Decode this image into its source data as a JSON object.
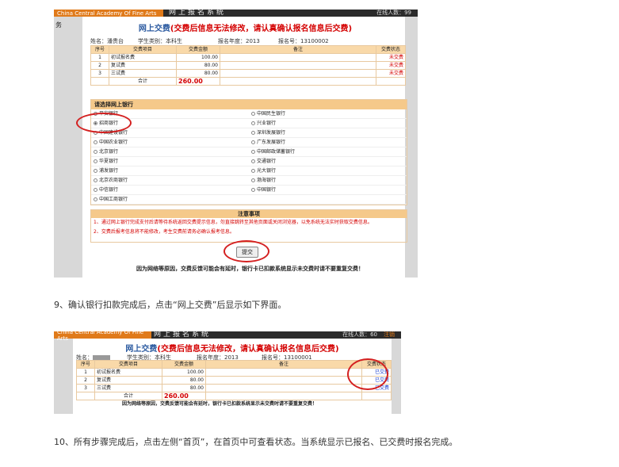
{
  "shot1": {
    "academy": "China Central Academy Of Fine Arts",
    "system_title": "网上报名系统",
    "online_text": "在线人数：99",
    "sidebar_label": "务",
    "page_title_blue": "网上交费",
    "page_title_red": "(交费后信息无法修改，请认真确认报名信息后交费)",
    "name_label": "姓名：潘贵台",
    "category_label": "学生类别：本科生",
    "year_label": "报名年度：2013",
    "regno_label": "报名号：13100002",
    "headers": [
      "序号",
      "交费项目",
      "交费金额",
      "备注",
      "交费状态"
    ],
    "rows": [
      {
        "no": "1",
        "item": "初试报名费",
        "amount": "100.00",
        "status": "未交费"
      },
      {
        "no": "2",
        "item": "复试费",
        "amount": "80.00",
        "status": "未交费"
      },
      {
        "no": "3",
        "item": "三试费",
        "amount": "80.00",
        "status": "未交费"
      }
    ],
    "total_label": "合计",
    "total_value": "260.00",
    "bank_header": "请选择网上银行",
    "banks_left": [
      "平安银行",
      "招商银行",
      "中国建设银行",
      "中国农业银行",
      "北京银行",
      "华夏银行",
      "浦发银行",
      "北京农商银行",
      "中信银行",
      "中国工商银行"
    ],
    "banks_right": [
      "中国民生银行",
      "兴业银行",
      "深圳发展银行",
      "广东发展银行",
      "中国邮政储蓄银行",
      "交通银行",
      "光大银行",
      "渤海银行",
      "中国银行"
    ],
    "notes_header": "注意事项",
    "notes": [
      "1、通过网上银行完成支付后请等待系统返回交费提示信息，勿直接跳转至其他页面或关闭浏览器，以免系统无法实时获取交费信息。",
      "2、交费后报考信息将不能修改，考生交费前请务必确认报考信息。"
    ],
    "submit_label": "提交",
    "warning": "因为网络等原因，交费反馈可能会有延时，银行卡已扣款系统显示未交费时请不要重复交费！"
  },
  "step9": "9、确认银行扣款完成后，点击“网上交费”后显示如下界面。",
  "shot2": {
    "academy": "China Central Academy Of Fine Arts",
    "system_title": "网上报名系统",
    "online_text": "在线人数：60",
    "logout": "注销",
    "page_title_blue": "网上交费",
    "page_title_red": "(交费后信息无法修改，请认真确认报名信息后交费)",
    "name_label": "姓名：",
    "category_label": "学生类别：本科生",
    "year_label": "报名年度：2013",
    "regno_label": "报名号：13100001",
    "headers": [
      "序号",
      "交费项目",
      "交费金额",
      "备注",
      "交费状态"
    ],
    "rows": [
      {
        "no": "1",
        "item": "初试报名费",
        "amount": "100.00",
        "status": "已交费"
      },
      {
        "no": "2",
        "item": "复试费",
        "amount": "80.00",
        "status": "已交费"
      },
      {
        "no": "3",
        "item": "三试费",
        "amount": "80.00",
        "status": "已交费"
      }
    ],
    "total_label": "合计",
    "total_value": "260.00",
    "warning": "因为网络等原因，交费反馈可能会有延时，银行卡已扣款系统显示未交费时请不要重复交费！"
  },
  "step10": "10、所有步骤完成后，点击左侧“首页”，在首页中可查看状态。当系统显示已报名、已交费时报名完成。"
}
